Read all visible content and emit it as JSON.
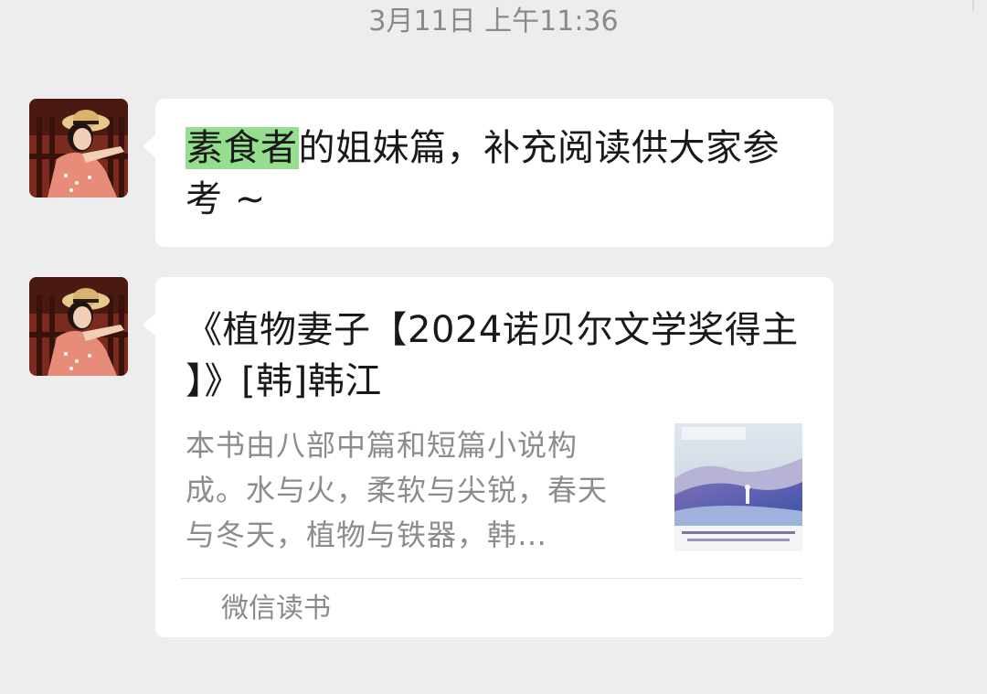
{
  "timestamp": "3月11日 上午11:36",
  "messages": [
    {
      "type": "text",
      "highlighted": "素食者",
      "text_rest": "的姐妹篇，补充阅读供大家参考 ~",
      "highlight_color": "#95de8f"
    },
    {
      "type": "link_card",
      "title": "《植物妻子【2024诺贝尔文学奖得主 】》[韩]韩江",
      "description": "本书由八部中篇和短篇小说构成。水与火，柔软与尖锐，春天与冬天，植物与铁器，韩…",
      "thumbnail_icon": "book-cover-icon",
      "source": "微信读书"
    }
  ],
  "colors": {
    "background": "#ededed",
    "bubble": "#ffffff",
    "text": "#191919",
    "muted_text": "#8c8c8c"
  }
}
